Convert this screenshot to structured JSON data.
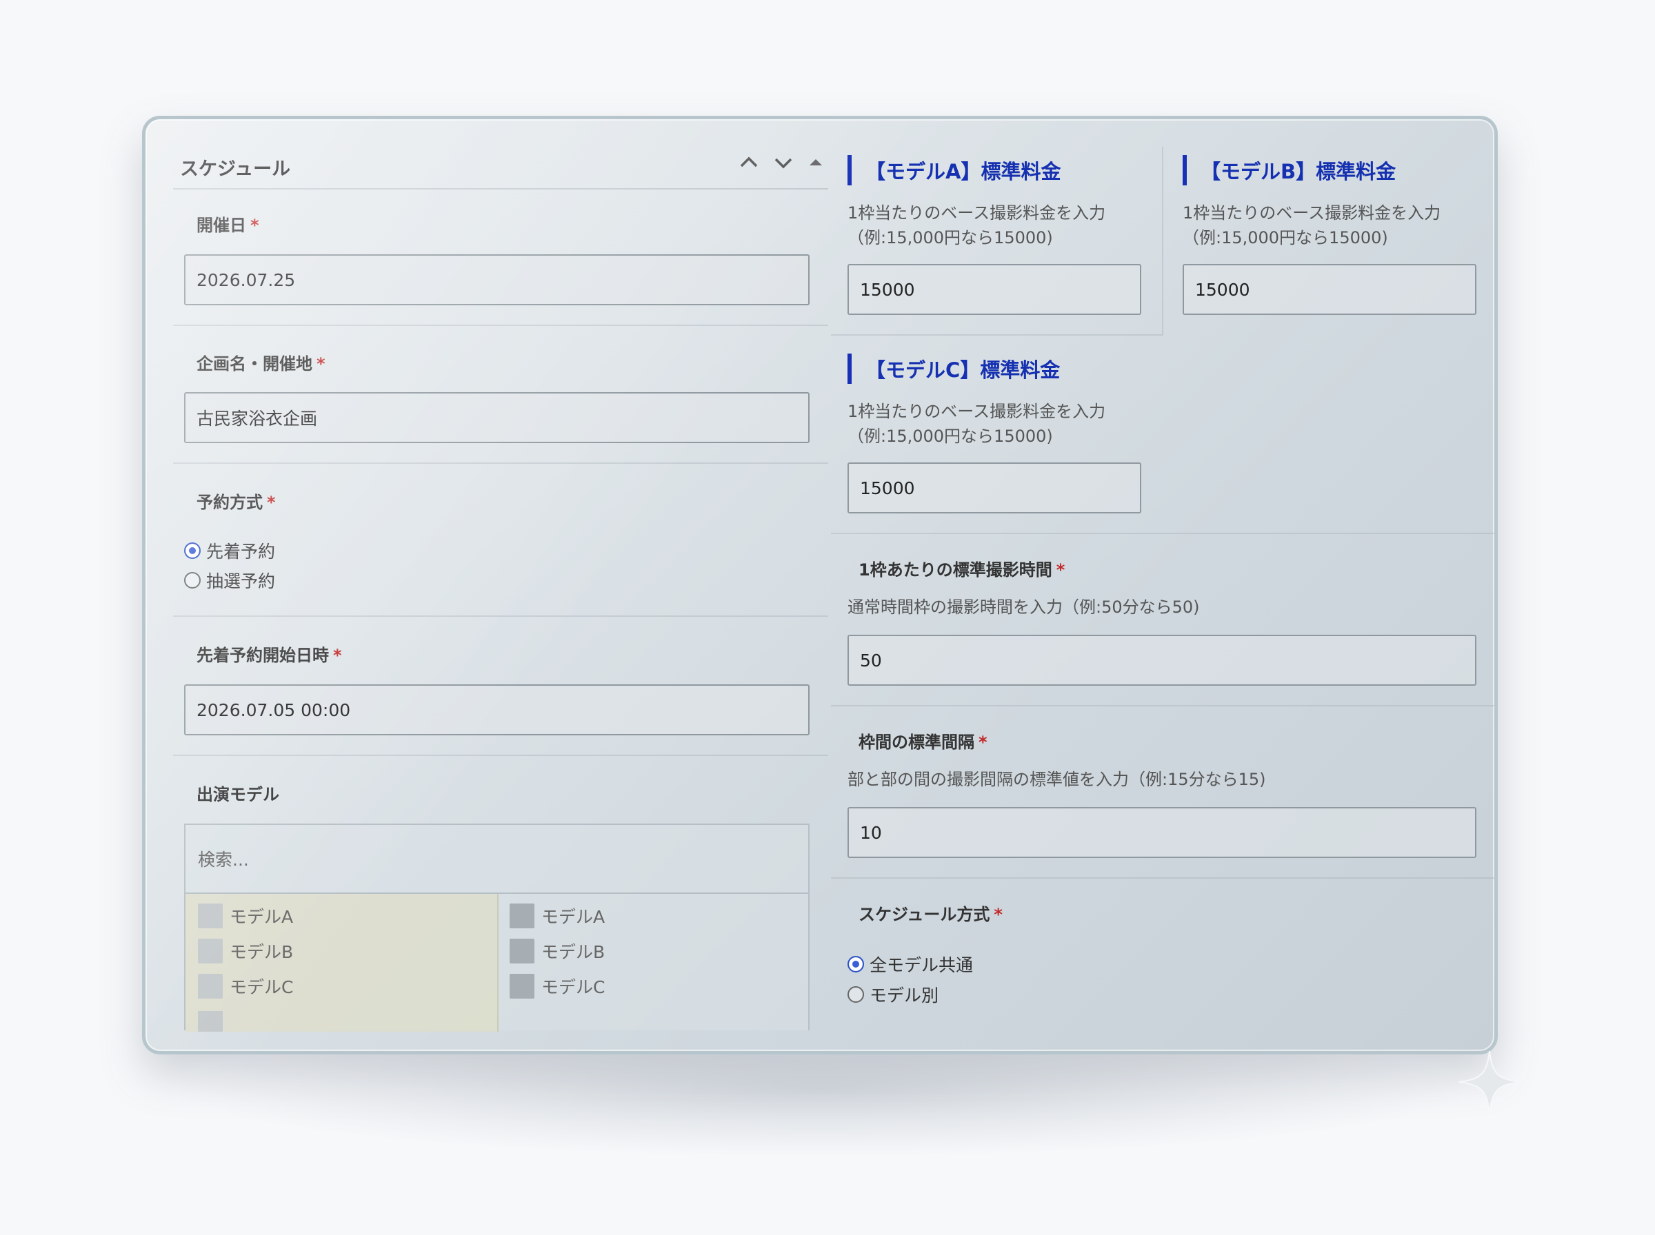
{
  "section": {
    "title": "スケジュール",
    "controls": [
      "^",
      "v",
      "▲"
    ]
  },
  "fields": {
    "event_date": {
      "label": "開催日",
      "required": "*",
      "value": "2026.07.25"
    },
    "project_name": {
      "label": "企画名・開催地",
      "required": "*",
      "value": "古民家浴衣企画"
    },
    "reservation_method": {
      "label": "予約方式",
      "required": "*",
      "options": [
        {
          "label": "先着予約",
          "selected": true
        },
        {
          "label": "抽選予約",
          "selected": false
        }
      ]
    },
    "first_come_start": {
      "label": "先着予約開始日時",
      "required": "*",
      "value": "2026.07.05 00:00"
    },
    "models": {
      "label": "出演モデル",
      "search_placeholder": "検索...",
      "available": [
        "モデルA",
        "モデルB",
        "モデルC"
      ],
      "selected": [
        "モデルA",
        "モデルB",
        "モデルC"
      ]
    }
  },
  "fees": [
    {
      "title": "【モデルA】標準料金",
      "help_line1": "1枠当たりのベース撮影料金を入力",
      "help_line2": "（例:15,000円なら15000)",
      "value": "15000"
    },
    {
      "title": "【モデルB】標準料金",
      "help_line1": "1枠当たりのベース撮影料金を入力",
      "help_line2": "（例:15,000円なら15000)",
      "value": "15000"
    },
    {
      "title": "【モデルC】標準料金",
      "help_line1": "1枠当たりのベース撮影料金を入力",
      "help_line2": "（例:15,000円なら15000)",
      "value": "15000"
    }
  ],
  "slot_duration": {
    "label": "1枠あたりの標準撮影時間",
    "required": "*",
    "help": "通常時間枠の撮影時間を入力（例:50分なら50)",
    "value": "50"
  },
  "slot_interval": {
    "label": "枠間の標準間隔",
    "required": "*",
    "help": "部と部の間の撮影間隔の標準値を入力（例:15分なら15)",
    "value": "10"
  },
  "schedule_method": {
    "label": "スケジュール方式",
    "required": "*",
    "options": [
      {
        "label": "全モデル共通",
        "selected": true
      },
      {
        "label": "モデル別",
        "selected": false
      }
    ]
  },
  "colors": {
    "accent_blue": "#1530b0",
    "required_red": "#c32a2a",
    "radio_selected": "#3a5fd6"
  }
}
